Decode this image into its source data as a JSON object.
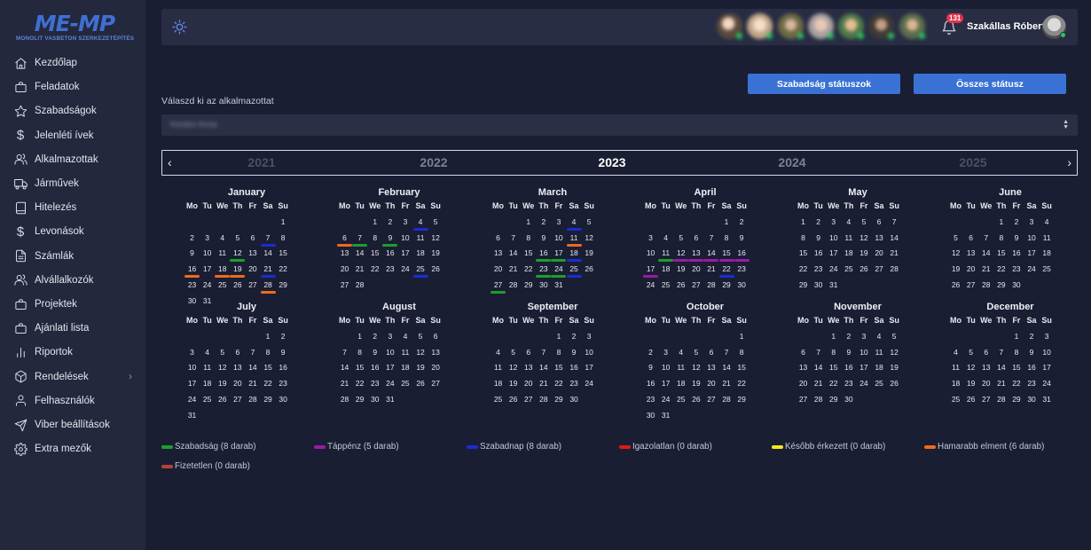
{
  "brand": {
    "logo_text": "ME-MP",
    "logo_subtitle": "MONOLIT VASBETON SZERKEZETÉPÍTÉS"
  },
  "sidebar": {
    "items": [
      {
        "label": "Kezdőlap",
        "icon": "home-icon"
      },
      {
        "label": "Feladatok",
        "icon": "briefcase-icon"
      },
      {
        "label": "Szabadságok",
        "icon": "star-icon"
      },
      {
        "label": "Jelenléti ívek",
        "icon": "dollar-icon"
      },
      {
        "label": "Alkalmazottak",
        "icon": "users-icon"
      },
      {
        "label": "Járművek",
        "icon": "truck-icon"
      },
      {
        "label": "Hitelezés",
        "icon": "book-icon"
      },
      {
        "label": "Levonások",
        "icon": "dollar-icon"
      },
      {
        "label": "Számlák",
        "icon": "file-icon"
      },
      {
        "label": "Alvállalkozók",
        "icon": "users-icon"
      },
      {
        "label": "Projektek",
        "icon": "briefcase-icon"
      },
      {
        "label": "Ajánlati lista",
        "icon": "briefcase-icon"
      },
      {
        "label": "Riportok",
        "icon": "bar-chart-icon"
      },
      {
        "label": "Rendelések",
        "icon": "box-icon",
        "has_submenu": true
      },
      {
        "label": "Felhasználók",
        "icon": "user-icon"
      },
      {
        "label": "Viber beállítások",
        "icon": "send-icon"
      },
      {
        "label": "Extra mezők",
        "icon": "gear-icon"
      }
    ]
  },
  "topbar": {
    "theme_icon": "sun-icon",
    "avatar_count": 7,
    "notification_count": "131",
    "user_name": "Szakállas Róbert",
    "user_status_color": "#27c75e"
  },
  "buttons": {
    "leave_statuses": "Szabadság státuszok",
    "all_statuses": "Összes státusz"
  },
  "employee_select": {
    "label": "Válaszd ki az alkalmazottat",
    "value": "Kovács Anna"
  },
  "years": {
    "prev_icon": "chevron-left-icon",
    "next_icon": "chevron-right-icon",
    "list": [
      "2021",
      "2022",
      "2023",
      "2024",
      "2025"
    ],
    "selected": "2023"
  },
  "weekdays": [
    "Mo",
    "Tu",
    "We",
    "Th",
    "Fr",
    "Sa",
    "Su"
  ],
  "months": [
    {
      "name": "January",
      "first_weekday": 6,
      "days": 31
    },
    {
      "name": "February",
      "first_weekday": 2,
      "days": 28
    },
    {
      "name": "March",
      "first_weekday": 2,
      "days": 31
    },
    {
      "name": "April",
      "first_weekday": 5,
      "days": 30
    },
    {
      "name": "May",
      "first_weekday": 0,
      "days": 31
    },
    {
      "name": "June",
      "first_weekday": 3,
      "days": 30
    },
    {
      "name": "July",
      "first_weekday": 5,
      "days": 31
    },
    {
      "name": "August",
      "first_weekday": 1,
      "days": 31
    },
    {
      "name": "September",
      "first_weekday": 4,
      "days": 30
    },
    {
      "name": "October",
      "first_weekday": 6,
      "days": 31
    },
    {
      "name": "November",
      "first_weekday": 2,
      "days": 30
    },
    {
      "name": "December",
      "first_weekday": 4,
      "days": 31
    }
  ],
  "marks": [
    {
      "month": 0,
      "day": 7,
      "type": "szabadnap"
    },
    {
      "month": 0,
      "day": 12,
      "type": "szabadsag"
    },
    {
      "month": 0,
      "day": 16,
      "type": "hamarabb"
    },
    {
      "month": 0,
      "day": 18,
      "type": "hamarabb"
    },
    {
      "month": 0,
      "day": 19,
      "type": "hamarabb"
    },
    {
      "month": 0,
      "day": 21,
      "type": "szabadnap"
    },
    {
      "month": 0,
      "day": 28,
      "type": "hamarabb"
    },
    {
      "month": 1,
      "day": 4,
      "type": "szabadnap"
    },
    {
      "month": 1,
      "day": 6,
      "type": "hamarabb"
    },
    {
      "month": 1,
      "day": 7,
      "type": "szabadsag"
    },
    {
      "month": 1,
      "day": 9,
      "type": "szabadsag"
    },
    {
      "month": 1,
      "day": 25,
      "type": "szabadnap"
    },
    {
      "month": 2,
      "day": 4,
      "type": "szabadnap"
    },
    {
      "month": 2,
      "day": 11,
      "type": "hamarabb"
    },
    {
      "month": 2,
      "day": 16,
      "type": "szabadsag"
    },
    {
      "month": 2,
      "day": 17,
      "type": "szabadsag"
    },
    {
      "month": 2,
      "day": 18,
      "type": "szabadnap"
    },
    {
      "month": 2,
      "day": 23,
      "type": "szabadsag"
    },
    {
      "month": 2,
      "day": 24,
      "type": "szabadsag"
    },
    {
      "month": 2,
      "day": 25,
      "type": "szabadnap"
    },
    {
      "month": 2,
      "day": 27,
      "type": "szabadsag"
    },
    {
      "month": 3,
      "day": 11,
      "type": "szabadsag"
    },
    {
      "month": 3,
      "day": 12,
      "type": "tappenz"
    },
    {
      "month": 3,
      "day": 13,
      "type": "tappenz"
    },
    {
      "month": 3,
      "day": 14,
      "type": "tappenz"
    },
    {
      "month": 3,
      "day": 15,
      "type": "tappenz"
    },
    {
      "month": 3,
      "day": 16,
      "type": "tappenz"
    },
    {
      "month": 3,
      "day": 17,
      "type": "tappenz"
    },
    {
      "month": 3,
      "day": 22,
      "type": "szabadnap"
    }
  ],
  "legend": [
    {
      "key": "szabadsag",
      "label": "Szabadság (8 darab)",
      "color": "#1e9e2c"
    },
    {
      "key": "tappenz",
      "label": "Táppénz (5 darab)",
      "color": "#9b1aa6"
    },
    {
      "key": "szabadnap",
      "label": "Szabadnap (8 darab)",
      "color": "#1b2bd6"
    },
    {
      "key": "igazolatlan",
      "label": "Igazolatlan (0 darab)",
      "color": "#e01818"
    },
    {
      "key": "kesobb",
      "label": "Később érkezett (0 darab)",
      "color": "#f2ea1c"
    },
    {
      "key": "hamarabb",
      "label": "Hamarabb elment (6 darab)",
      "color": "#f06a1c"
    },
    {
      "key": "fizetetlen",
      "label": "Fizetetlen (0 darab)",
      "color": "#b4433a"
    }
  ]
}
